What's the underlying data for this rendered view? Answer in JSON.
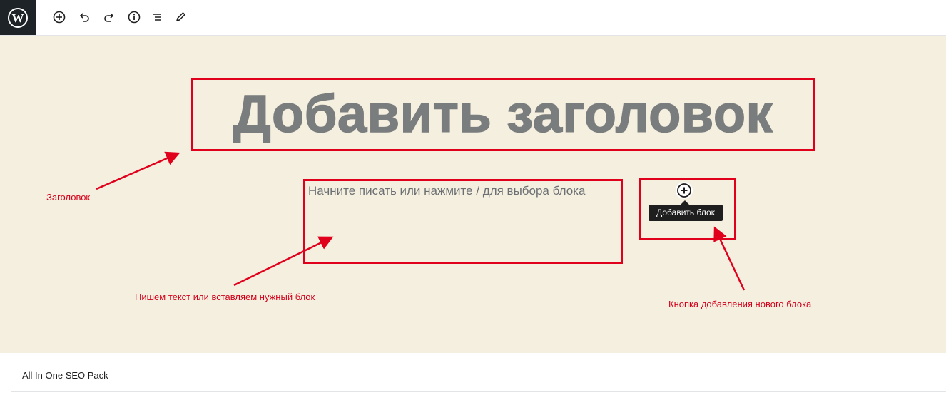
{
  "editor": {
    "title_placeholder": "Добавить заголовок",
    "block_placeholder": "Начните писать или нажмите / для выбора блока",
    "add_block_tooltip": "Добавить блок"
  },
  "toolbar": {
    "items": [
      {
        "name": "add-block",
        "icon": "plus-circle-icon"
      },
      {
        "name": "undo",
        "icon": "undo-icon"
      },
      {
        "name": "redo",
        "icon": "redo-icon"
      },
      {
        "name": "info",
        "icon": "info-icon"
      },
      {
        "name": "list-view",
        "icon": "list-view-icon"
      },
      {
        "name": "tools",
        "icon": "pencil-icon"
      }
    ]
  },
  "annotations": {
    "title_label": "Заголовок",
    "text_label": "Пишем текст или вставляем нужный блок",
    "add_block_label": "Кнопка добавления нового блока"
  },
  "panels": {
    "seo_title": "All In One SEO Pack"
  },
  "colors": {
    "annotation_red": "#e0001b",
    "canvas_bg": "#f5efe0",
    "logo_bg": "#1e2327"
  }
}
